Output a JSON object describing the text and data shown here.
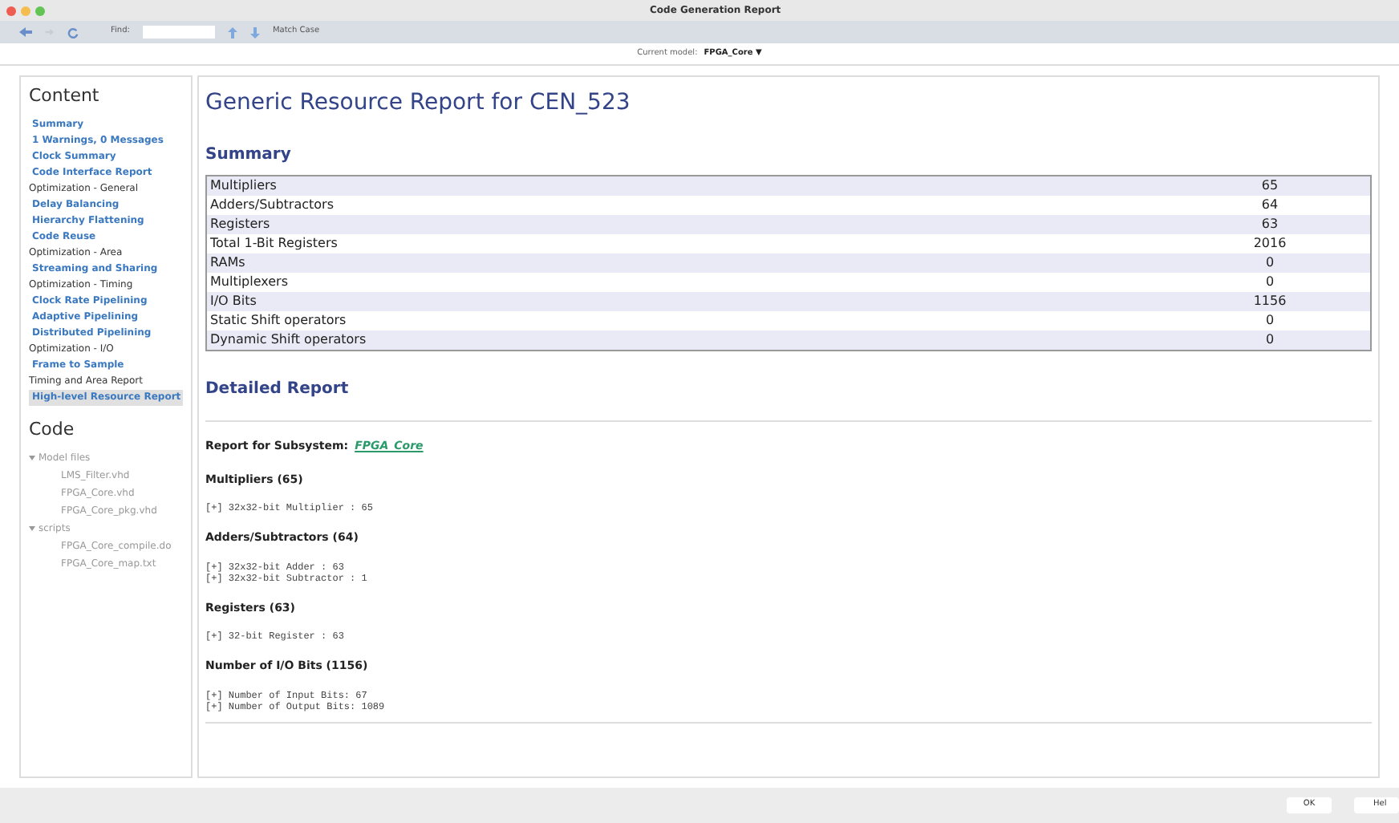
{
  "window": {
    "title": "Code Generation Report"
  },
  "toolbar": {
    "find_label": "Find:",
    "match_case": "Match Case"
  },
  "model_bar": {
    "label": "Current model:",
    "model": "FPGA_Core",
    "caret": "▼"
  },
  "sidebar": {
    "content_title": "Content",
    "items": [
      {
        "label": "Summary",
        "kind": "link",
        "selected": false
      },
      {
        "label": "1 Warnings, 0 Messages",
        "kind": "link",
        "selected": false
      },
      {
        "label": "Clock Summary",
        "kind": "link",
        "selected": false
      },
      {
        "label": "Code Interface Report",
        "kind": "link",
        "selected": false
      },
      {
        "label": "Optimization - General",
        "kind": "header",
        "selected": false
      },
      {
        "label": "Delay Balancing",
        "kind": "link",
        "selected": false
      },
      {
        "label": "Hierarchy Flattening",
        "kind": "link",
        "selected": false
      },
      {
        "label": "Code Reuse",
        "kind": "link",
        "selected": false
      },
      {
        "label": "Optimization - Area",
        "kind": "header",
        "selected": false
      },
      {
        "label": "Streaming and Sharing",
        "kind": "link",
        "selected": false
      },
      {
        "label": "Optimization - Timing",
        "kind": "header",
        "selected": false
      },
      {
        "label": "Clock Rate Pipelining",
        "kind": "link",
        "selected": false
      },
      {
        "label": "Adaptive Pipelining",
        "kind": "link",
        "selected": false
      },
      {
        "label": "Distributed Pipelining",
        "kind": "link",
        "selected": false
      },
      {
        "label": "Optimization - I/O",
        "kind": "header",
        "selected": false
      },
      {
        "label": "Frame to Sample",
        "kind": "link",
        "selected": false
      },
      {
        "label": "Timing and Area Report",
        "kind": "header",
        "selected": false
      },
      {
        "label": "High-level Resource Report",
        "kind": "link",
        "selected": true
      }
    ],
    "code_title": "Code",
    "code_tree": [
      {
        "label": "Model files",
        "expanded": true,
        "children": [
          {
            "label": "LMS_Filter.vhd"
          },
          {
            "label": "FPGA_Core.vhd"
          },
          {
            "label": "FPGA_Core_pkg.vhd"
          }
        ]
      },
      {
        "label": "scripts",
        "expanded": true,
        "children": [
          {
            "label": "FPGA_Core_compile.do"
          },
          {
            "label": "FPGA_Core_map.txt"
          }
        ]
      }
    ]
  },
  "report": {
    "title": "Generic Resource Report for CEN_523",
    "summary_title": "Summary",
    "summary_rows": [
      {
        "name": "Multipliers",
        "value": "65"
      },
      {
        "name": "Adders/Subtractors",
        "value": "64"
      },
      {
        "name": "Registers",
        "value": "63"
      },
      {
        "name": "Total 1-Bit Registers",
        "value": "2016"
      },
      {
        "name": "RAMs",
        "value": "0"
      },
      {
        "name": "Multiplexers",
        "value": "0"
      },
      {
        "name": "I/O Bits",
        "value": "1156"
      },
      {
        "name": "Static Shift operators",
        "value": "0"
      },
      {
        "name": "Dynamic Shift operators",
        "value": "0"
      }
    ],
    "detailed_title": "Detailed Report",
    "subsystem_label": "Report for Subsystem:",
    "subsystem_link": "FPGA_Core",
    "sections": [
      {
        "heading": "Multipliers (65)",
        "lines": [
          "[+] 32x32-bit Multiplier : 65"
        ]
      },
      {
        "heading": "Adders/Subtractors (64)",
        "lines": [
          "[+] 32x32-bit Adder : 63",
          "[+] 32x32-bit Subtractor : 1"
        ]
      },
      {
        "heading": "Registers (63)",
        "lines": [
          "[+] 32-bit Register : 63"
        ]
      },
      {
        "heading": "Number of I/O Bits (1156)",
        "lines": [
          "[+] Number of Input Bits: 67",
          "[+] Number of Output Bits: 1089"
        ]
      }
    ]
  },
  "buttons": [
    "OK",
    "Hel"
  ]
}
